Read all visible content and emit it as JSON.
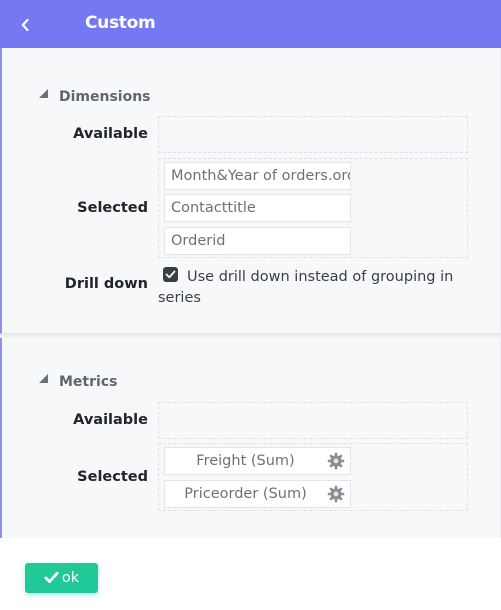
{
  "header": {
    "title": "Custom"
  },
  "dimensions": {
    "title": "Dimensions",
    "available_label": "Available",
    "selected_label": "Selected",
    "selected": [
      "Month&Year of orders.orderdate",
      "Contacttitle",
      "Orderid"
    ],
    "drilldown_label": "Drill down",
    "drilldown_text": "Use drill down instead of grouping in series",
    "drilldown_checked": true
  },
  "metrics": {
    "title": "Metrics",
    "available_label": "Available",
    "selected_label": "Selected",
    "selected": [
      "Freight (Sum)",
      "Priceorder (Sum)"
    ]
  },
  "footer": {
    "ok_label": "ok"
  },
  "icons": {
    "back": "chevron-left-icon",
    "collapse": "triangle-collapse-icon",
    "gear": "gear-icon",
    "check": "check-icon"
  },
  "colors": {
    "header": "#7479f2",
    "panel_border": "#8d91ee",
    "ok_button": "#20c997"
  }
}
